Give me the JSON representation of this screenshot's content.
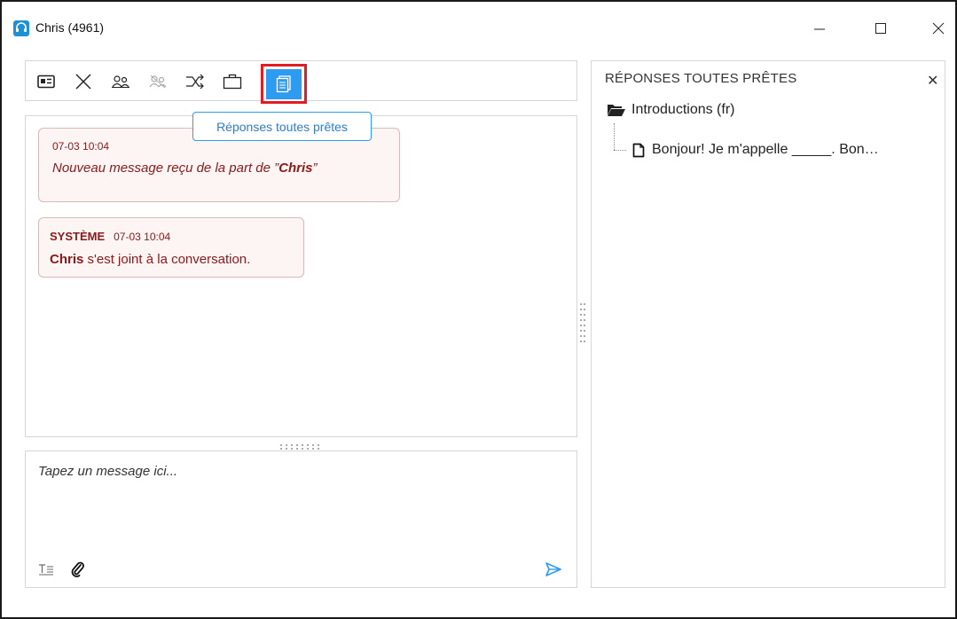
{
  "window": {
    "title": "Chris (4961)",
    "minimize": "—",
    "maximize": "☐",
    "close": "✕"
  },
  "toolbar": {
    "items": [
      {
        "name": "contact-card-icon"
      },
      {
        "name": "close-conversation-icon"
      },
      {
        "name": "conference-icon"
      },
      {
        "name": "conference-disabled-icon"
      },
      {
        "name": "transfer-icon"
      },
      {
        "name": "briefcase-icon"
      },
      {
        "name": "ready-responses-icon",
        "active": true
      }
    ],
    "tooltip": "Réponses toutes prêtes",
    "active_color": "#2d9bf0",
    "highlight_color": "#e31c23"
  },
  "messages": [
    {
      "time": "07-03 10:04",
      "body_prefix": "Nouveau message reçu de la part de ”",
      "name": "Chris",
      "body_suffix": "”"
    },
    {
      "sender": "SYSTÈME",
      "time": "07-03 10:04",
      "name": "Chris",
      "body_suffix": " s'est joint à la conversation."
    }
  ],
  "composer": {
    "placeholder": "Tapez un message ici...",
    "value": ""
  },
  "ready_responses": {
    "title": "RÉPONSES TOUTES PRÊTES",
    "close": "✕",
    "folder": "Introductions (fr)",
    "item": "Bonjour! Je m'appelle _____. Bon…"
  },
  "colors": {
    "message_text": "#8b1a1a",
    "message_bg": "#fdf4f4",
    "accent": "#2d9bf0"
  }
}
